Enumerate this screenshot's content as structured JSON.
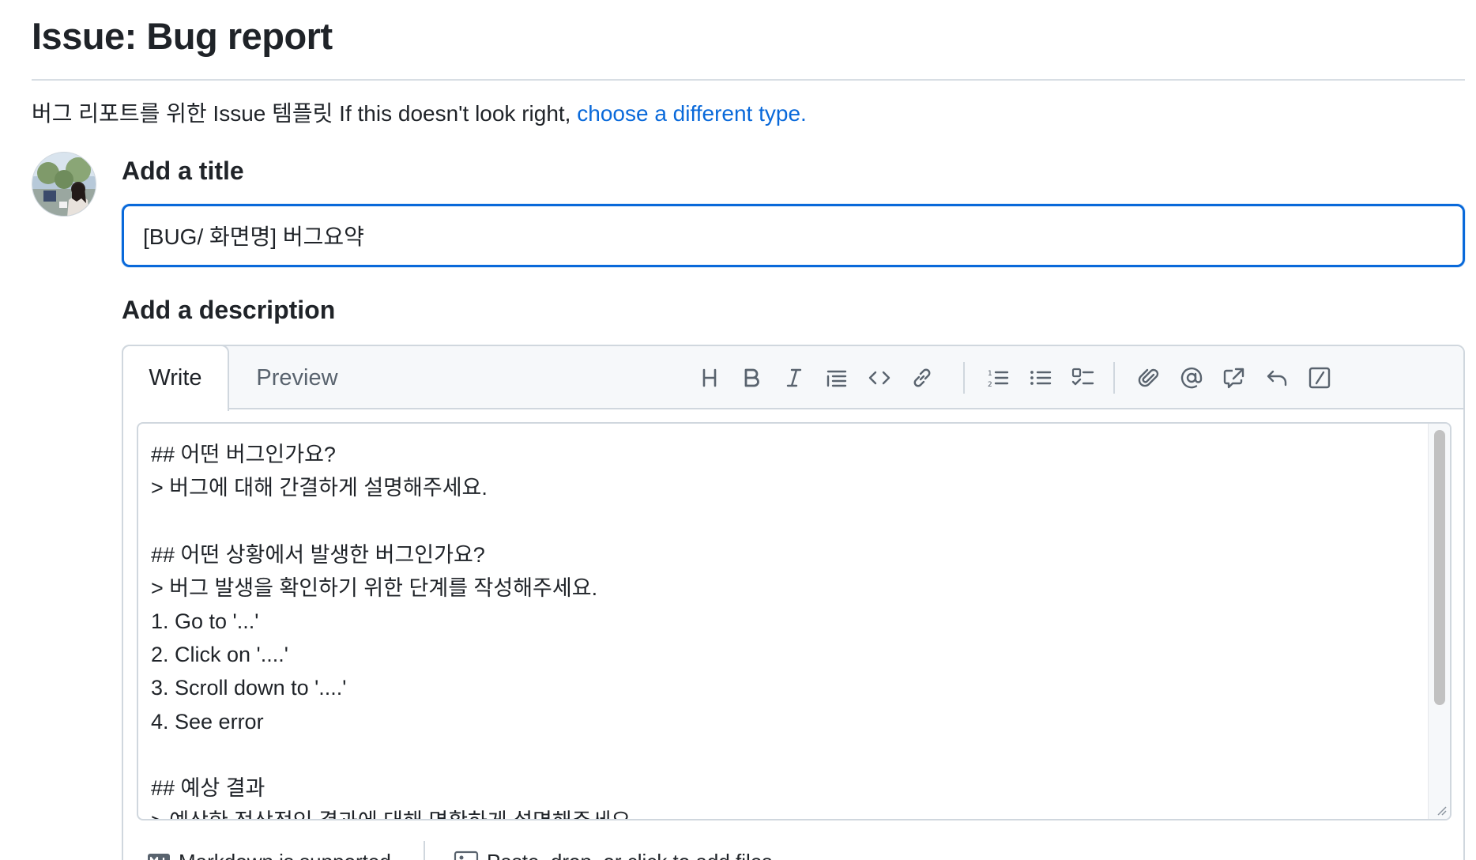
{
  "page": {
    "title": "Issue: Bug report",
    "subtitle_text": "버그 리포트를 위한 Issue 템플릿 If this doesn't look right,",
    "subtitle_link": "choose a different type."
  },
  "title_field": {
    "label": "Add a title",
    "value": "[BUG/ 화면명] 버그요약"
  },
  "description": {
    "label": "Add a description",
    "tabs": {
      "write": "Write",
      "preview": "Preview"
    },
    "toolbar_icons": [
      "heading-icon",
      "bold-icon",
      "italic-icon",
      "quote-icon",
      "code-icon",
      "link-icon",
      "numbered-list-icon",
      "unordered-list-icon",
      "task-list-icon",
      "attach-icon",
      "mention-icon",
      "cross-reference-icon",
      "undo-icon",
      "slash-command-icon"
    ],
    "body": "## 어떤 버그인가요?\n> 버그에 대해 간결하게 설명해주세요.\n\n## 어떤 상황에서 발생한 버그인가요?\n> 버그 발생을 확인하기 위한 단계를 작성해주세요.\n1. Go to '...'\n2. Click on '....'\n3. Scroll down to '....'\n4. See error\n\n## 예상 결과\n> 예상한 정상적인 결과에 대해 명확하게 설명해주세요.",
    "footer": {
      "markdown_label": "Markdown is supported",
      "files_label": "Paste, drop, or click to add files"
    }
  },
  "colors": {
    "accent": "#0969da",
    "text": "#1f2328",
    "muted": "#59636e",
    "border": "#d0d7de",
    "header_bg": "#f6f8fa"
  }
}
